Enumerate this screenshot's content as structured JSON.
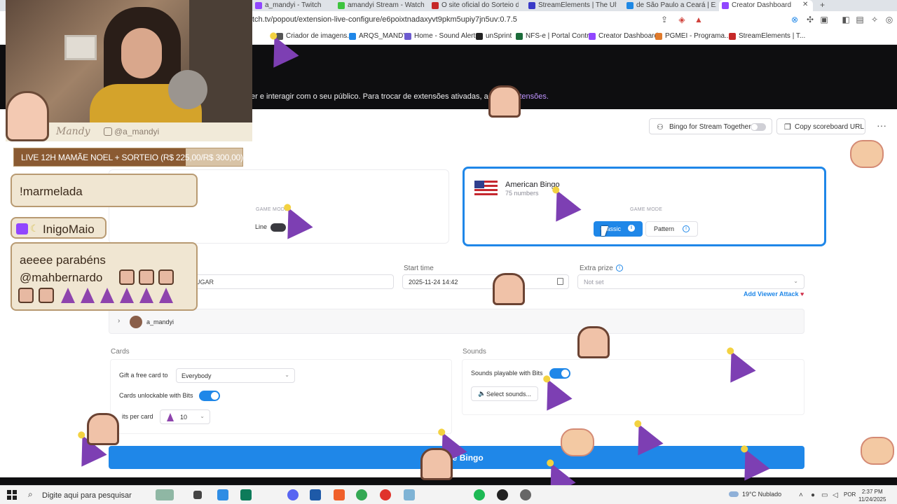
{
  "browser": {
    "tabs": [
      {
        "label": "a_mandyi - Twitch"
      },
      {
        "label": "amandyi Stream - Watch"
      },
      {
        "label": "O site oficial do Sorteio de"
      },
      {
        "label": "StreamElements | The Ultim"
      },
      {
        "label": "de São Paulo a Ceará | Expli"
      },
      {
        "label": "Creator Dashboard"
      }
    ],
    "url": "tch.tv/popout/extension-live-configure/e6poixtnadaxyvt9pkm5upiy7jn5uv:0.7.5",
    "bookmarks": [
      {
        "label": "Criador de imagens..."
      },
      {
        "label": "ARQS_MANDY"
      },
      {
        "label": "Home - Sound Alerts"
      },
      {
        "label": "unSprint"
      },
      {
        "label": "NFS-e | Portal Contr..."
      },
      {
        "label": "Creator Dashboard"
      },
      {
        "label": "PGMEI - Programa..."
      },
      {
        "label": "StreamElements | T..."
      }
    ]
  },
  "header": {
    "text": "er e interagir com o seu público. Para trocar de extensões ativadas, acesse ",
    "link": "Extensões."
  },
  "webcam": {
    "name": "Mandy",
    "handle": "@a_mandyi"
  },
  "goal": {
    "text": "LIVE 12H MAMÃE NOEL + SORTEIO (R$ 225,00/R$ 300,00)",
    "progress": 0.75
  },
  "chat": {
    "msg1": "!marmelada",
    "user": "InigoMaio",
    "msg2_line1": "aeeee parabéns",
    "msg2_line2": "@mahbernardo"
  },
  "toolbar": {
    "stream_together": "Bingo for Stream Together",
    "copy_url": "Copy scoreboard URL",
    "more": "···"
  },
  "game": {
    "left_mode_label": "GAME MODE",
    "line_label": "Line",
    "american_title": "American Bingo",
    "american_sub": "75 numbers",
    "american_mode_label": "GAME MODE",
    "classic": "Classic",
    "pattern": "Pattern"
  },
  "form": {
    "title_value": "UGAR",
    "start_label": "Start time",
    "start_value": "2025-11-24 14:42",
    "prize_label": "Extra prize",
    "prize_placeholder": "Not set",
    "viewer_attack": "Add Viewer Attack",
    "streamer": "a_mandyi"
  },
  "cards": {
    "title": "Cards",
    "gift_label": "Gift a free card to",
    "gift_value": "Everybody",
    "unlock_label": "Cards unlockable with Bits",
    "bits_label": "its per card",
    "bits_value": "10"
  },
  "sounds": {
    "title": "Sounds",
    "playable_label": "Sounds playable with Bits",
    "select": "Select sounds..."
  },
  "create_button": "Create Bingo",
  "taskbar": {
    "search_placeholder": "Digite aqui para pesquisar",
    "weather": "19°C  Nublado",
    "lang": "POR",
    "time": "2:37 PM",
    "date": "11/24/2025"
  },
  "colors": {
    "accent": "#1f87e8",
    "twitch_purple": "#9146ff",
    "chat_bg": "#f0e6d2",
    "chat_border": "#b89a72"
  }
}
